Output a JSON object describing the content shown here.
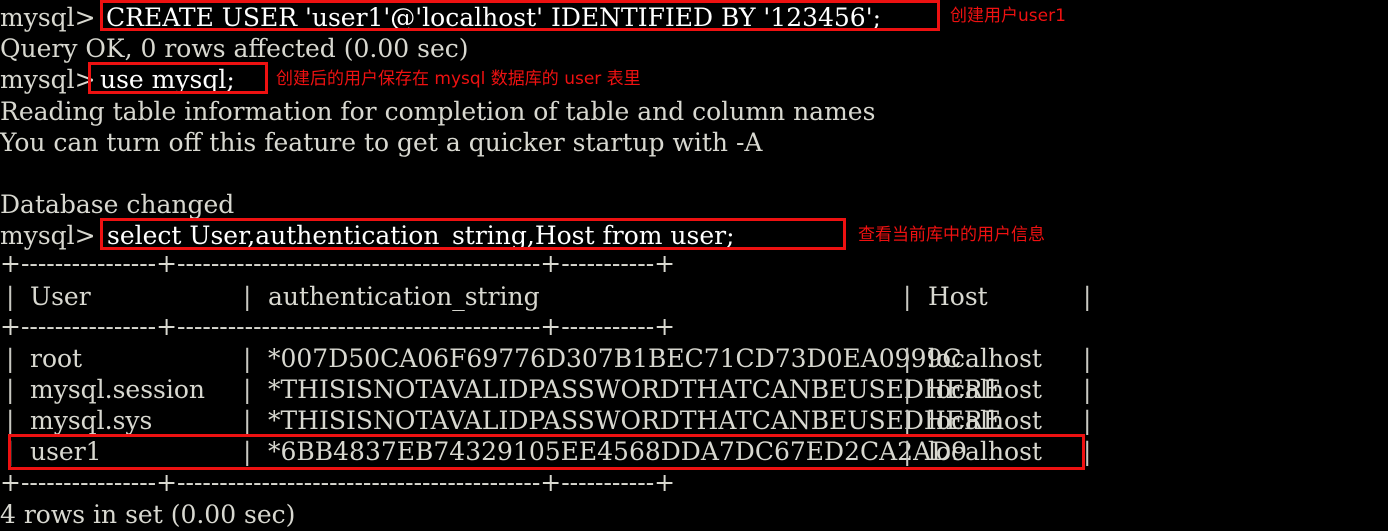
{
  "terminal": {
    "prompt": "mysql> ",
    "lines": [
      {
        "id": "line-create-user",
        "prompt": "mysql> ",
        "text": "CREATE USER 'user1'@'localhost' IDENTIFIED BY '123456';"
      },
      {
        "id": "line-query-ok",
        "prompt": "",
        "text": "Query OK, 0 rows affected (0.00 sec)"
      },
      {
        "id": "line-use-mysql",
        "prompt": "mysql> ",
        "text": "use mysql;"
      },
      {
        "id": "line-reading-table",
        "prompt": "",
        "text": "Reading table information for completion of table and column names"
      },
      {
        "id": "line-turn-off",
        "prompt": "",
        "text": "You can turn off this feature to get a quicker startup with -A"
      },
      {
        "id": "line-blank",
        "prompt": "",
        "text": ""
      },
      {
        "id": "line-db-changed",
        "prompt": "",
        "text": "Database changed"
      },
      {
        "id": "line-select-users",
        "prompt": "mysql> ",
        "text": "select User,authentication_string,Host from user;"
      }
    ],
    "result_footer": "4 rows in set (0.00 sec)"
  },
  "annotations": [
    {
      "id": "note-create-user",
      "text": "创建用户user1"
    },
    {
      "id": "note-use-mysql",
      "text": "创建后的用户保存在 mysql 数据库的 user 表里"
    },
    {
      "id": "note-select-users",
      "text": "查看当前库中的用户信息"
    }
  ],
  "result_table": {
    "border_top": "+----------------+-------------------------------------------+-----------+",
    "border_mid": "+----------------+-------------------------------------------+-----------+",
    "border_bottom": "+----------------+-------------------------------------------+-----------+",
    "columns": [
      "User",
      "authentication_string",
      "Host"
    ],
    "rows": [
      {
        "user": "root",
        "authentication_string": "*007D50CA06F69776D307B1BEC71CD73D0EA0999C",
        "host": "localhost",
        "highlighted": false
      },
      {
        "user": "mysql.session",
        "authentication_string": "*THISISNOTAVALIDPASSWORDTHATCANBEUSEDHERE",
        "host": "localhost",
        "highlighted": false
      },
      {
        "user": "mysql.sys",
        "authentication_string": "*THISISNOTAVALIDPASSWORDTHATCANBEUSEDHERE",
        "host": "localhost",
        "highlighted": false
      },
      {
        "user": "user1",
        "authentication_string": "*6BB4837EB74329105EE4568DDA7DC67ED2CA2AD9",
        "host": "localhost",
        "highlighted": true
      }
    ],
    "pipe": "|"
  },
  "colors": {
    "background": "#000000",
    "foreground": "#d8d8d0",
    "highlight": "#ee1111",
    "border": "#c9c9c2"
  }
}
